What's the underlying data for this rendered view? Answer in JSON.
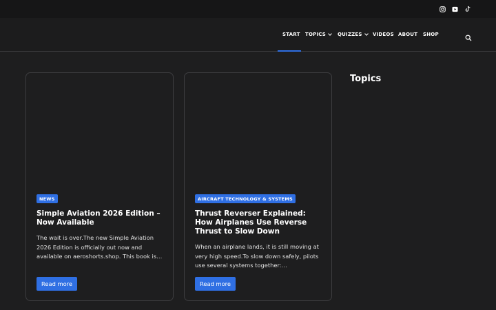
{
  "topbar": {
    "social": [
      {
        "name": "instagram-icon"
      },
      {
        "name": "youtube-icon"
      },
      {
        "name": "tiktok-icon"
      }
    ]
  },
  "nav": {
    "items": [
      {
        "label": "START",
        "active": true
      },
      {
        "label": "TOPICS",
        "has_dropdown": true
      },
      {
        "label": "QUIZZES",
        "has_dropdown": true
      },
      {
        "label": "VIDEOS"
      },
      {
        "label": "ABOUT"
      },
      {
        "label": "SHOP"
      }
    ],
    "search_icon": "search-icon"
  },
  "posts": [
    {
      "category": "NEWS",
      "title": "Simple Aviation 2026 Edition – Now Available",
      "excerpt": "The wait is over.The new Simple Aviation 2026 Edition is officially out now and available on aeroshorts.shop. This book is…",
      "button": "Read more"
    },
    {
      "category": "AIRCRAFT TECHNOLOGY & SYSTEMS",
      "title": "Thrust Reverser Explained: How Airplanes Use Reverse Thrust to Slow Down",
      "excerpt": "When an airplane lands, it is still moving at very high speed.To slow down safely, pilots use several systems together:…",
      "button": "Read more"
    }
  ],
  "sidebar": {
    "title": "Topics"
  },
  "colors": {
    "accent": "#2f6fe3",
    "background": "#1e1e1f",
    "topbar": "#161617"
  }
}
